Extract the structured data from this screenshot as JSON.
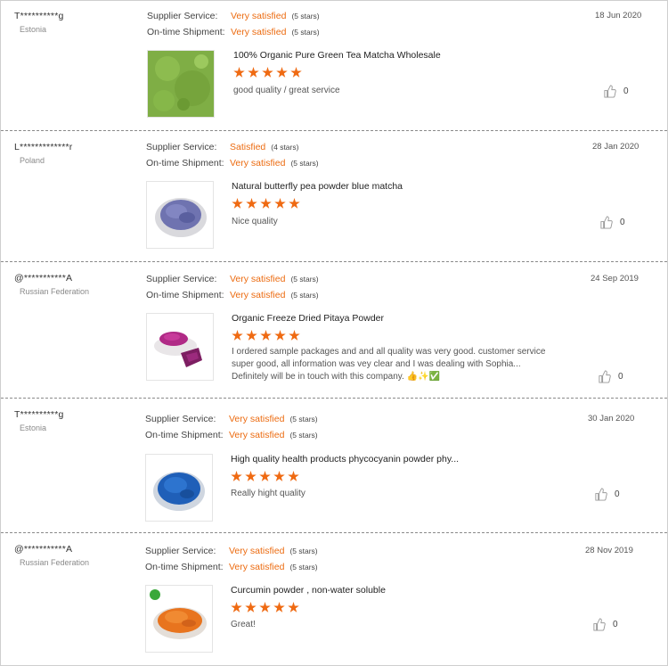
{
  "labels": {
    "supplier_service": "Supplier Service:",
    "ontime_shipment": "On-time Shipment:"
  },
  "icons": {
    "like": "thumbs-up-icon",
    "star": "star-icon"
  },
  "colors": {
    "accent": "#ec6b10",
    "star": "#ef6a12"
  },
  "reviews": [
    {
      "buyer": "T**********g",
      "country": "Estonia",
      "date": "18 Jun 2020",
      "supplier_rating": "Very satisfied",
      "supplier_stars": "(5 stars)",
      "shipment_rating": "Very satisfied",
      "shipment_stars": "(5 stars)",
      "product": "100% Organic Pure Green Tea Matcha Wholesale",
      "star_count": 5,
      "comment": "good quality / great service",
      "likes": "0"
    },
    {
      "buyer": "L*************r",
      "country": "Poland",
      "date": "28 Jan 2020",
      "supplier_rating": "Satisfied",
      "supplier_stars": "(4 stars)",
      "shipment_rating": "Very satisfied",
      "shipment_stars": "(5 stars)",
      "product": "Natural butterfly pea powder blue matcha",
      "star_count": 5,
      "comment": "Nice quality",
      "likes": "0"
    },
    {
      "buyer": "@***********A",
      "country": "Russian Federation",
      "date": "24 Sep 2019",
      "supplier_rating": "Very satisfied",
      "supplier_stars": "(5 stars)",
      "shipment_rating": "Very satisfied",
      "shipment_stars": "(5 stars)",
      "product": "Organic Freeze Dried Pitaya Powder",
      "star_count": 5,
      "comment": "I ordered sample packages and and all quality was very good. customer service super good, all information was vey clear and I was dealing with Sophia... Definitely will be in touch with this company. 👍✨✅",
      "likes": "0"
    },
    {
      "buyer": "T**********g",
      "country": "Estonia",
      "date": "30 Jan 2020",
      "supplier_rating": "Very satisfied",
      "supplier_stars": "(5 stars)",
      "shipment_rating": "Very satisfied",
      "shipment_stars": "(5 stars)",
      "product": "High quality health products phycocyanin powder phy...",
      "star_count": 5,
      "comment": "Really hight quality",
      "likes": "0"
    },
    {
      "buyer": "@***********A",
      "country": "Russian Federation",
      "date": "28 Nov 2019",
      "supplier_rating": "Very satisfied",
      "supplier_stars": "(5 stars)",
      "shipment_rating": "Very satisfied",
      "shipment_stars": "(5 stars)",
      "product": "Curcumin powder , non-water soluble",
      "star_count": 5,
      "comment": "Great!",
      "likes": "0"
    }
  ]
}
